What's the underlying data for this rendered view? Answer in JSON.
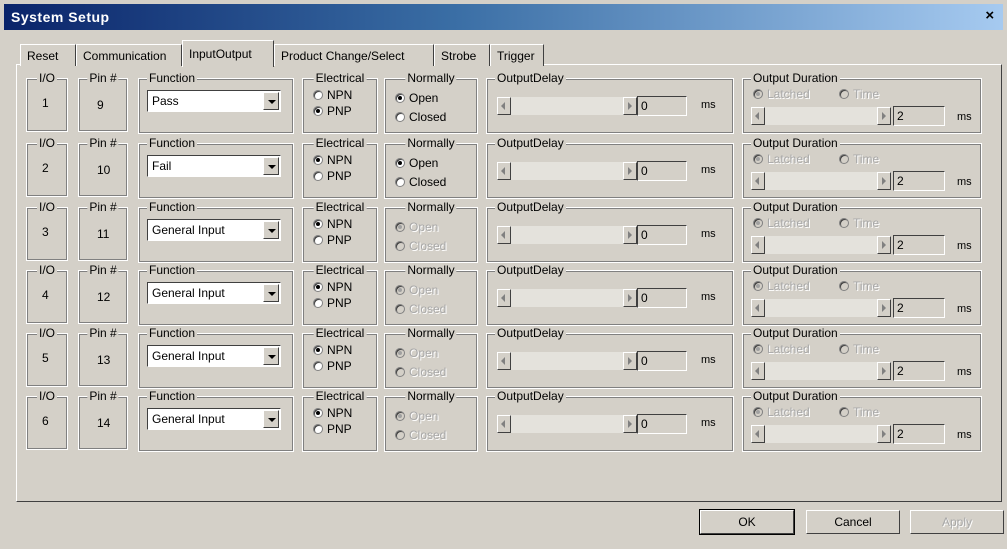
{
  "window": {
    "title": "System Setup",
    "close_glyph": "×"
  },
  "tabs": [
    {
      "label": "Reset"
    },
    {
      "label": "Communication"
    },
    {
      "label": "InputOutput",
      "active": true
    },
    {
      "label": "Product Change/Select"
    },
    {
      "label": "Strobe"
    },
    {
      "label": "Trigger"
    }
  ],
  "labels": {
    "io": "I/O",
    "pin": "Pin #",
    "function": "Function",
    "electrical": "Electrical",
    "normally": "Normally",
    "output_delay": "OutputDelay",
    "output_duration": "Output Duration",
    "npn": "NPN",
    "pnp": "PNP",
    "open": "Open",
    "closed": "Closed",
    "latched": "Latched",
    "time": "Time",
    "ms": "ms"
  },
  "rows": [
    {
      "io": "1",
      "pin": "9",
      "function": "Pass",
      "electrical": "PNP",
      "normally_enabled": true,
      "normally": "Open",
      "delay": "0",
      "duration": "2"
    },
    {
      "io": "2",
      "pin": "10",
      "function": "Fail",
      "electrical": "NPN",
      "normally_enabled": true,
      "normally": "Open",
      "delay": "0",
      "duration": "2"
    },
    {
      "io": "3",
      "pin": "11",
      "function": "General Input",
      "electrical": "NPN",
      "normally_enabled": false,
      "normally": "Open",
      "delay": "0",
      "duration": "2"
    },
    {
      "io": "4",
      "pin": "12",
      "function": "General Input",
      "electrical": "NPN",
      "normally_enabled": false,
      "normally": "Open",
      "delay": "0",
      "duration": "2"
    },
    {
      "io": "5",
      "pin": "13",
      "function": "General Input",
      "electrical": "NPN",
      "normally_enabled": false,
      "normally": "Open",
      "delay": "0",
      "duration": "2"
    },
    {
      "io": "6",
      "pin": "14",
      "function": "General Input",
      "electrical": "NPN",
      "normally_enabled": false,
      "normally": "Open",
      "delay": "0",
      "duration": "2"
    }
  ],
  "buttons": {
    "ok": "OK",
    "cancel": "Cancel",
    "apply": "Apply"
  }
}
